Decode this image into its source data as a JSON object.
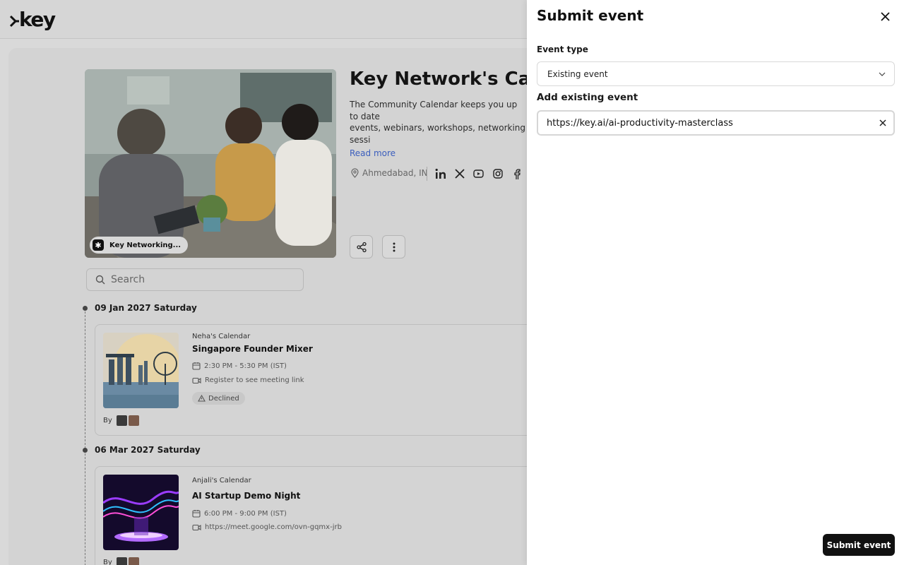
{
  "app": {
    "logo_text": "key"
  },
  "calendar": {
    "title": "Key Network's Calendar",
    "description": "The Community Calendar keeps you up to date\nevents, webinars, workshops, networking sessi\nschedule so you never miss an opportunity to\n...",
    "read_more": "Read more",
    "location": "Ahmedabad, IN",
    "badge": "Key Networking..."
  },
  "search": {
    "placeholder": "Search"
  },
  "events": [
    {
      "date": "09 Jan 2027 Saturday",
      "calendar": "Neha's Calendar",
      "title": "Singapore Founder Mixer",
      "time": "2:30 PM - 5:30 PM (IST)",
      "link": "Register to see meeting link",
      "status": "Declined",
      "by": "By"
    },
    {
      "date": "06 Mar 2027 Saturday",
      "calendar": "Anjali's Calendar",
      "title": "AI Startup Demo Night",
      "time": "6:00 PM - 9:00 PM (IST)",
      "link": "https://meet.google.com/ovn-gqmx-jrb",
      "by": "By"
    }
  ],
  "panel": {
    "title": "Submit event",
    "event_type_label": "Event type",
    "event_type_value": "Existing event",
    "add_existing_label": "Add existing event",
    "url_value": "https://key.ai/ai-productivity-masterclass",
    "submit_label": "Submit event"
  }
}
